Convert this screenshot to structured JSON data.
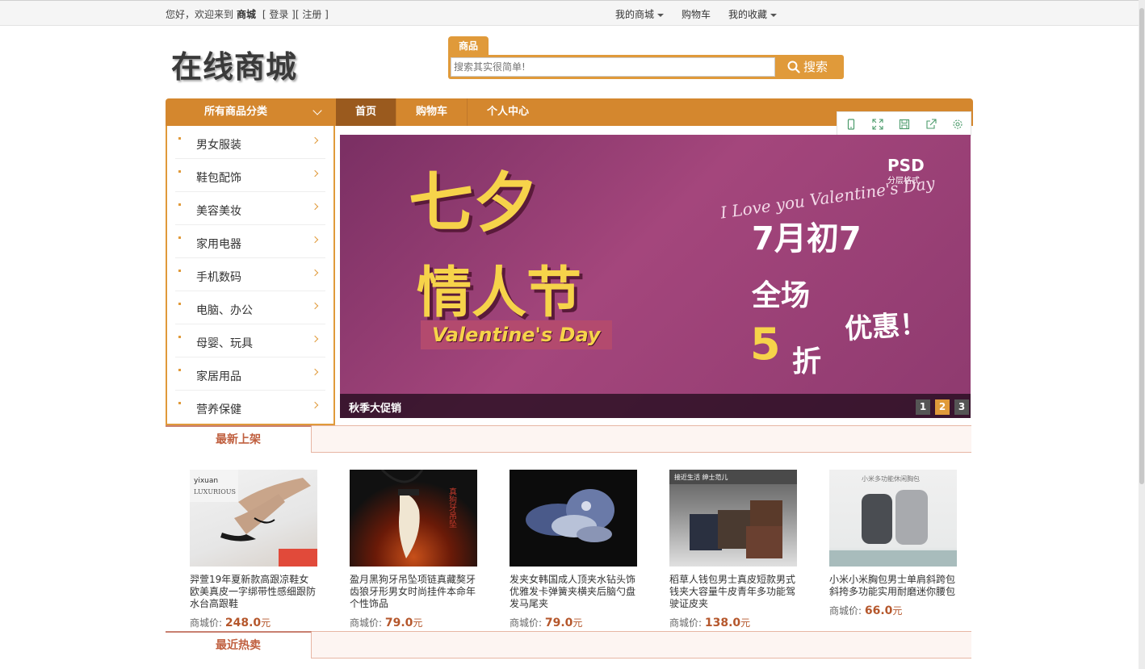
{
  "topbar": {
    "greeting": "您好，欢迎来到",
    "site": "商城",
    "login": "[ 登录 ]",
    "register": "[ 注册 ]",
    "my_mall": "我的商城",
    "cart": "购物车",
    "favorites": "我的收藏"
  },
  "header": {
    "logo": "在线商城",
    "search_tab": "商品",
    "search_placeholder": "搜索其实很简单!",
    "search_button": "搜索"
  },
  "nav": {
    "category_title": "所有商品分类",
    "items": [
      "首页",
      "购物车",
      "个人中心"
    ]
  },
  "sidebar": {
    "items": [
      "男女服装",
      "鞋包配饰",
      "美容美妆",
      "家用电器",
      "手机数码",
      "电脑、办公",
      "母婴、玩具",
      "家居用品",
      "营养保健"
    ]
  },
  "banner": {
    "main": "七夕",
    "sub": "情人节",
    "eng": "Valentine's Day",
    "psd": "PSD",
    "psd_sub": "分层格式",
    "script": "I Love you Valentine's Day",
    "date": "7月初7",
    "all": "全场",
    "five": "5",
    "zhe": "折",
    "youhui": "优惠！",
    "caption": "秋季大促销",
    "dots": [
      "1",
      "2",
      "3"
    ]
  },
  "sections": {
    "new": "最新上架",
    "hot": "最近热卖"
  },
  "products": [
    {
      "name": "羿萱19年夏新款高跟凉鞋女欧美真皮一字绑带性感细跟防水台高跟鞋",
      "price_label": "商城价:",
      "price": "248.0",
      "unit": "元"
    },
    {
      "name": "盈月黑狗牙吊坠项链真藏獒牙齿狼牙形男女时尚挂件本命年个性饰品",
      "price_label": "商城价:",
      "price": "79.0",
      "unit": "元"
    },
    {
      "name": "发夹女韩国成人顶夹水钻头饰优雅发卡弹簧夹横夹后脑勺盘发马尾夹",
      "price_label": "商城价:",
      "price": "79.0",
      "unit": "元"
    },
    {
      "name": "稻草人钱包男士真皮短款男式钱夹大容量牛皮青年多功能驾驶证皮夹",
      "price_label": "商城价:",
      "price": "138.0",
      "unit": "元"
    },
    {
      "name": "小米小米胸包男士单肩斜跨包斜挎多功能实用耐磨迷你腰包",
      "price_label": "商城价:",
      "price": "66.0",
      "unit": "元"
    }
  ],
  "colors": {
    "accent": "#e09a3a",
    "nav": "#d4872e",
    "price": "#b5572c"
  }
}
